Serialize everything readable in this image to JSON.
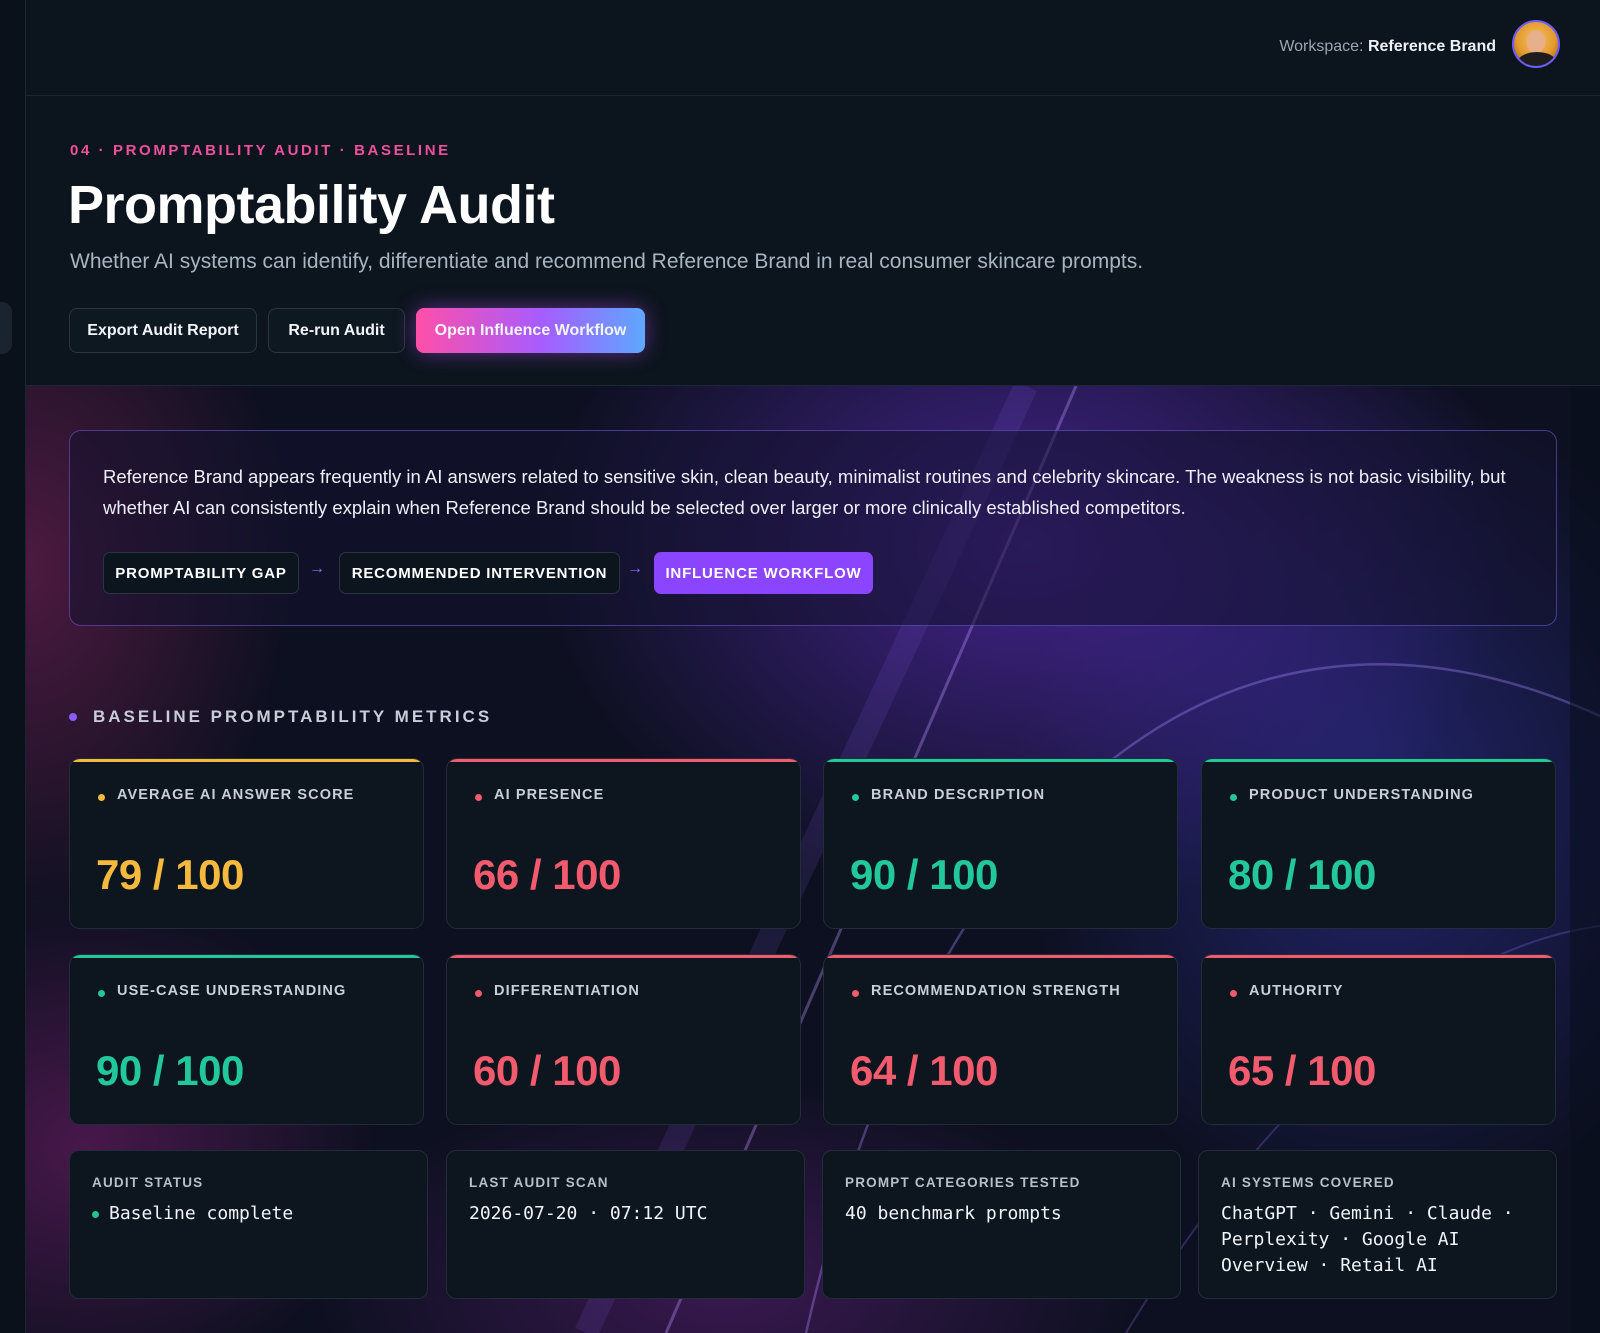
{
  "topbar": {
    "workspace_prefix": "Workspace:",
    "workspace_name": "Reference Brand"
  },
  "header": {
    "eyebrow": "04 · PROMPTABILITY AUDIT · BASELINE",
    "title": "Promptability Audit",
    "subtitle": "Whether AI systems can identify, differentiate and recommend Reference Brand in real consumer skincare prompts.",
    "buttons": {
      "export": "Export Audit Report",
      "rerun": "Re-run Audit",
      "open_workflow": "Open Influence Workflow"
    }
  },
  "summary": {
    "text": "Reference Brand appears frequently in AI answers related to sensitive skin, clean beauty, minimalist routines and celebrity skincare. The weakness is not basic visibility, but whether AI can consistently explain when Reference Brand should be selected over larger or more clinically established competitors.",
    "chips": [
      "PROMPTABILITY GAP",
      "RECOMMENDED INTERVENTION",
      "INFLUENCE WORKFLOW"
    ],
    "arrow": "→"
  },
  "section": {
    "heading": "BASELINE PROMPTABILITY METRICS"
  },
  "metrics": [
    {
      "label": "AVERAGE AI ANSWER SCORE",
      "score": "79 / 100",
      "color": "#f5b93d"
    },
    {
      "label": "AI PRESENCE",
      "score": "66 / 100",
      "color": "#f25a6e"
    },
    {
      "label": "BRAND DESCRIPTION",
      "score": "90 / 100",
      "color": "#22c79a"
    },
    {
      "label": "PRODUCT UNDERSTANDING",
      "score": "80 / 100",
      "color": "#22c79a"
    },
    {
      "label": "USE-CASE UNDERSTANDING",
      "score": "90 / 100",
      "color": "#22c79a"
    },
    {
      "label": "DIFFERENTIATION",
      "score": "60 / 100",
      "color": "#f25a6e"
    },
    {
      "label": "RECOMMENDATION STRENGTH",
      "score": "64 / 100",
      "color": "#f25a6e"
    },
    {
      "label": "AUTHORITY",
      "score": "65 / 100",
      "color": "#f25a6e"
    }
  ],
  "status_cards": [
    {
      "label": "AUDIT STATUS",
      "value": "Baseline complete"
    },
    {
      "label": "LAST AUDIT SCAN",
      "value": "2026-07-20 · 07:12 UTC"
    },
    {
      "label": "PROMPT CATEGORIES TESTED",
      "value": "40 benchmark prompts"
    },
    {
      "label": "AI SYSTEMS COVERED",
      "value": "ChatGPT · Gemini · Claude · Perplexity · Google AI Overview · Retail AI"
    }
  ],
  "colors": {
    "accent_pink": "#f0509c",
    "accent_purple": "#8b45ff",
    "good": "#22c79a",
    "warn": "#f5b93d",
    "bad": "#f25a6e"
  }
}
